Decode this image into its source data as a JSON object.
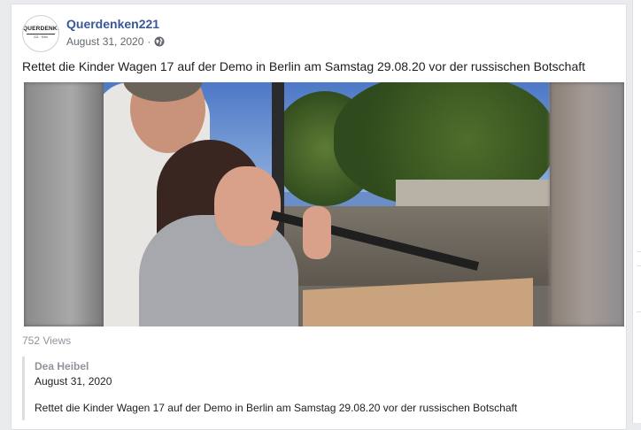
{
  "post": {
    "page_name": "Querdenken221",
    "avatar_text": "QUERDENKEN",
    "avatar_subtext": "221 · Köln",
    "date": "August 31, 2020",
    "separator": "·",
    "privacy_icon": "globe-icon",
    "text": "Rettet die Kinder Wagen 17 auf der Demo in Berlin am Samstag 29.08.20 vor der russischen Botschaft",
    "views": "752 Views"
  },
  "shared": {
    "author": "Dea Heibel",
    "date": "August 31, 2020",
    "text": "Rettet die Kinder Wagen 17 auf der Demo in Berlin am Samstag 29.08.20 vor der russischen Botschaft"
  },
  "colors": {
    "link_blue": "#385898",
    "background": "#e9ebee",
    "card_border": "#dddfe2"
  }
}
